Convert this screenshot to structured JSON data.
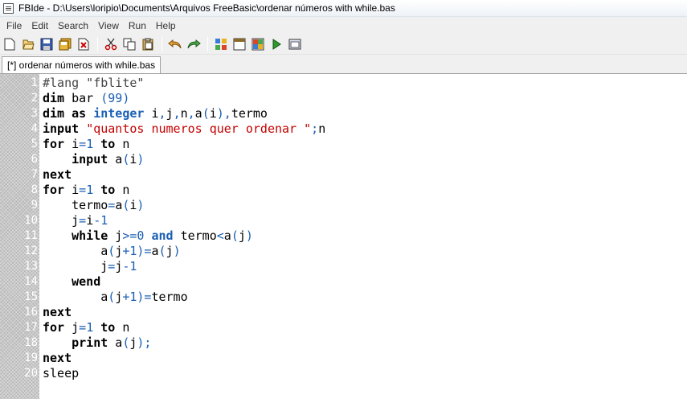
{
  "window": {
    "title": "FBIde - D:\\Users\\loripio\\Documents\\Arquivos FreeBasic\\ordenar números with while.bas"
  },
  "menu": [
    "File",
    "Edit",
    "Search",
    "View",
    "Run",
    "Help"
  ],
  "toolbar": {
    "icons": [
      "new-file-icon",
      "open-file-icon",
      "save-icon",
      "save-all-icon",
      "close-file-icon",
      "cut-icon",
      "copy-icon",
      "paste-icon",
      "undo-icon",
      "redo-icon",
      "compile-icon",
      "compile-run-icon",
      "run-icon",
      "run-arrow-icon",
      "output-window-icon"
    ]
  },
  "tab": {
    "label": "[*] ordenar números with while.bas"
  },
  "colors": {
    "keyword": "#000000",
    "keyword_blue": "#1a5fb4",
    "string": "#c40000",
    "number": "#1a5fb4",
    "gutter": "#b8b8b8"
  },
  "code": [
    {
      "n": "1",
      "t": [
        [
          "cmt",
          "#lang \"fblite\""
        ]
      ]
    },
    {
      "n": "2",
      "t": [
        [
          "kw",
          "dim"
        ],
        [
          "id",
          " bar "
        ],
        [
          "op",
          "("
        ],
        [
          "num",
          "99"
        ],
        [
          "op",
          ")"
        ]
      ]
    },
    {
      "n": "3",
      "t": [
        [
          "kw",
          "dim"
        ],
        [
          "id",
          " "
        ],
        [
          "kw",
          "as"
        ],
        [
          "id",
          " "
        ],
        [
          "kwb",
          "integer"
        ],
        [
          "id",
          " i"
        ],
        [
          "op",
          ","
        ],
        [
          "id",
          "j"
        ],
        [
          "op",
          ","
        ],
        [
          "id",
          "n"
        ],
        [
          "op",
          ","
        ],
        [
          "id",
          "a"
        ],
        [
          "op",
          "("
        ],
        [
          "id",
          "i"
        ],
        [
          "op",
          ")"
        ],
        [
          "op",
          ","
        ],
        [
          "id",
          "termo"
        ]
      ]
    },
    {
      "n": "4",
      "t": [
        [
          "kw",
          "input"
        ],
        [
          "id",
          " "
        ],
        [
          "str",
          "\"quantos numeros quer ordenar \""
        ],
        [
          "op",
          ";"
        ],
        [
          "id",
          "n"
        ]
      ]
    },
    {
      "n": "5",
      "t": [
        [
          "kw",
          "for"
        ],
        [
          "id",
          " i"
        ],
        [
          "op",
          "="
        ],
        [
          "num",
          "1"
        ],
        [
          "id",
          " "
        ],
        [
          "kw",
          "to"
        ],
        [
          "id",
          " n"
        ]
      ]
    },
    {
      "n": "6",
      "t": [
        [
          "id",
          "    "
        ],
        [
          "kw",
          "input"
        ],
        [
          "id",
          " a"
        ],
        [
          "op",
          "("
        ],
        [
          "id",
          "i"
        ],
        [
          "op",
          ")"
        ]
      ]
    },
    {
      "n": "7",
      "t": [
        [
          "kw",
          "next"
        ]
      ]
    },
    {
      "n": "8",
      "t": [
        [
          "kw",
          "for"
        ],
        [
          "id",
          " i"
        ],
        [
          "op",
          "="
        ],
        [
          "num",
          "1"
        ],
        [
          "id",
          " "
        ],
        [
          "kw",
          "to"
        ],
        [
          "id",
          " n"
        ]
      ]
    },
    {
      "n": "9",
      "t": [
        [
          "id",
          "    termo"
        ],
        [
          "op",
          "="
        ],
        [
          "id",
          "a"
        ],
        [
          "op",
          "("
        ],
        [
          "id",
          "i"
        ],
        [
          "op",
          ")"
        ]
      ]
    },
    {
      "n": "10",
      "t": [
        [
          "id",
          "    j"
        ],
        [
          "op",
          "="
        ],
        [
          "id",
          "i"
        ],
        [
          "op",
          "-"
        ],
        [
          "num",
          "1"
        ]
      ]
    },
    {
      "n": "11",
      "t": [
        [
          "id",
          "    "
        ],
        [
          "kw",
          "while"
        ],
        [
          "id",
          " j"
        ],
        [
          "op",
          ">="
        ],
        [
          "num",
          "0"
        ],
        [
          "id",
          " "
        ],
        [
          "kwb",
          "and"
        ],
        [
          "id",
          " termo"
        ],
        [
          "op",
          "<"
        ],
        [
          "id",
          "a"
        ],
        [
          "op",
          "("
        ],
        [
          "id",
          "j"
        ],
        [
          "op",
          ")"
        ]
      ]
    },
    {
      "n": "12",
      "t": [
        [
          "id",
          "        a"
        ],
        [
          "op",
          "("
        ],
        [
          "id",
          "j"
        ],
        [
          "op",
          "+"
        ],
        [
          "num",
          "1"
        ],
        [
          "op",
          ")="
        ],
        [
          "id",
          "a"
        ],
        [
          "op",
          "("
        ],
        [
          "id",
          "j"
        ],
        [
          "op",
          ")"
        ]
      ]
    },
    {
      "n": "13",
      "t": [
        [
          "id",
          "        j"
        ],
        [
          "op",
          "="
        ],
        [
          "id",
          "j"
        ],
        [
          "op",
          "-"
        ],
        [
          "num",
          "1"
        ]
      ]
    },
    {
      "n": "14",
      "t": [
        [
          "id",
          "    "
        ],
        [
          "kw",
          "wend"
        ]
      ]
    },
    {
      "n": "15",
      "t": [
        [
          "id",
          "        a"
        ],
        [
          "op",
          "("
        ],
        [
          "id",
          "j"
        ],
        [
          "op",
          "+"
        ],
        [
          "num",
          "1"
        ],
        [
          "op",
          ")="
        ],
        [
          "id",
          "termo"
        ]
      ]
    },
    {
      "n": "16",
      "t": [
        [
          "kw",
          "next"
        ]
      ]
    },
    {
      "n": "17",
      "t": [
        [
          "kw",
          "for"
        ],
        [
          "id",
          " j"
        ],
        [
          "op",
          "="
        ],
        [
          "num",
          "1"
        ],
        [
          "id",
          " "
        ],
        [
          "kw",
          "to"
        ],
        [
          "id",
          " n"
        ]
      ]
    },
    {
      "n": "18",
      "t": [
        [
          "id",
          "    "
        ],
        [
          "kw",
          "print"
        ],
        [
          "id",
          " a"
        ],
        [
          "op",
          "("
        ],
        [
          "id",
          "j"
        ],
        [
          "op",
          ");"
        ]
      ]
    },
    {
      "n": "19",
      "t": [
        [
          "kw",
          "next"
        ]
      ]
    },
    {
      "n": "20",
      "t": [
        [
          "id",
          "sleep"
        ]
      ]
    }
  ]
}
